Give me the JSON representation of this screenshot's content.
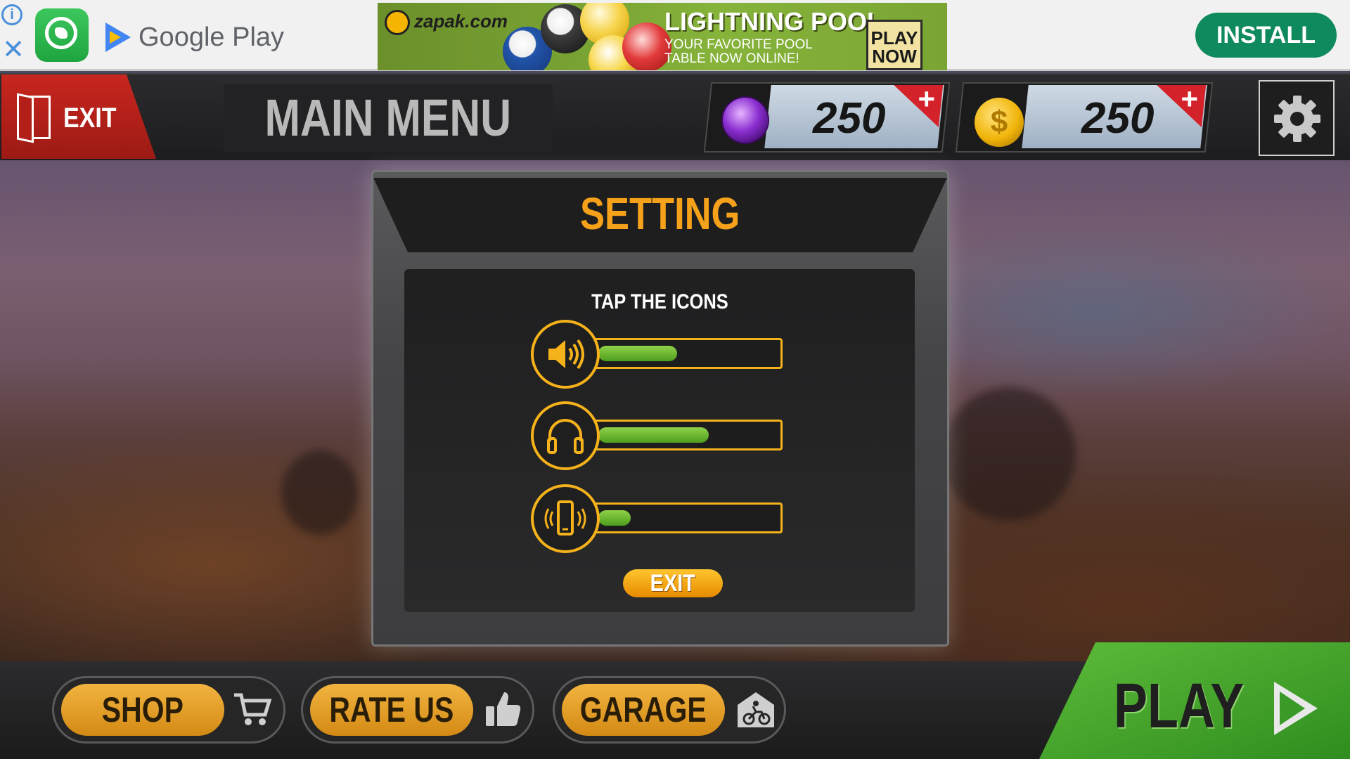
{
  "ad": {
    "store_name": "Google Play",
    "sponsor": "zapak.com",
    "headline": "LIGHTNING POOL",
    "tagline": "YOUR FAVORITE POOL TABLE NOW ONLINE!",
    "cta": "PLAY NOW",
    "install_label": "INSTALL",
    "info_icon": "info-icon",
    "close_icon": "close-icon",
    "app_icon": "whatsapp-icon",
    "store_icon": "google-play-icon"
  },
  "top_bar": {
    "exit_label": "EXIT",
    "title": "MAIN MENU",
    "gems": {
      "amount": "250",
      "plus": "+",
      "icon": "gem-icon"
    },
    "coins": {
      "amount": "250",
      "plus": "+",
      "symbol": "$",
      "icon": "coin-icon"
    },
    "settings_icon": "gear-icon"
  },
  "settings": {
    "title": "SETTING",
    "subtitle": "TAP THE ICONS",
    "rows": [
      {
        "name": "sound",
        "icon": "speaker-icon",
        "level": 0.44
      },
      {
        "name": "music",
        "icon": "headphones-icon",
        "level": 0.62
      },
      {
        "name": "vibration",
        "icon": "vibration-icon",
        "level": 0.18
      }
    ],
    "exit_label": "EXIT"
  },
  "bottom_bar": {
    "shop_label": "SHOP",
    "rate_label": "RATE US",
    "garage_label": "GARAGE",
    "play_label": "PLAY",
    "shop_icon": "cart-icon",
    "rate_icon": "thumbs-up-icon",
    "garage_icon": "garage-icon",
    "play_icon": "play-arrow-icon"
  },
  "colors": {
    "accent_orange": "#f5a21a",
    "level_green": "#6fb834",
    "exit_red": "#c8261e",
    "play_green": "#4aa630",
    "install_green": "#0f8a5c"
  }
}
